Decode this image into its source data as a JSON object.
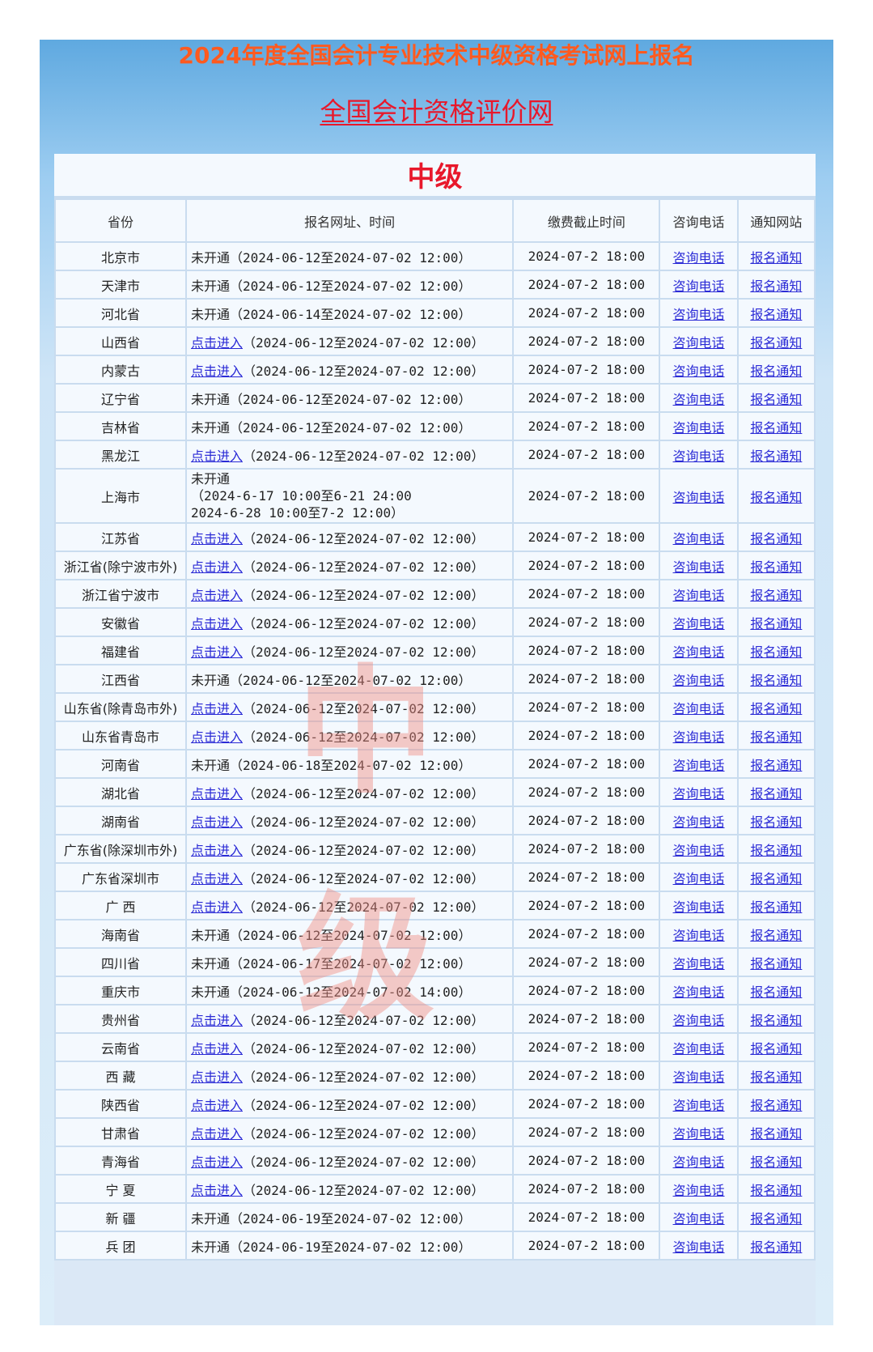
{
  "header": {
    "headline": "2024年度全国会计专业技术中级资格考试网上报名",
    "subtitle_link": "全国会计资格评价网"
  },
  "table": {
    "level_title": "中级",
    "watermark": "中级",
    "columns": [
      "省份",
      "报名网址、时间",
      "缴费截止时间",
      "咨询电话",
      "通知网站"
    ],
    "phone_link_label": "咨询电话",
    "notice_link_label": "报名通知",
    "rows": [
      {
        "province": "北京市",
        "status": "未开通",
        "status_link": false,
        "period": "（2024-06-12至2024-07-02 12:00）",
        "deadline": "2024-07-2 18:00"
      },
      {
        "province": "天津市",
        "status": "未开通",
        "status_link": false,
        "period": "（2024-06-12至2024-07-02 12:00）",
        "deadline": "2024-07-2 18:00"
      },
      {
        "province": "河北省",
        "status": "未开通",
        "status_link": false,
        "period": "（2024-06-14至2024-07-02 12:00）",
        "deadline": "2024-07-2 18:00"
      },
      {
        "province": "山西省",
        "status": "点击进入",
        "status_link": true,
        "period": "（2024-06-12至2024-07-02 12:00）",
        "deadline": "2024-07-2 18:00"
      },
      {
        "province": "内蒙古",
        "status": "点击进入",
        "status_link": true,
        "period": "（2024-06-12至2024-07-02 12:00）",
        "deadline": "2024-07-2 18:00"
      },
      {
        "province": "辽宁省",
        "status": "未开通",
        "status_link": false,
        "period": "（2024-06-12至2024-07-02 12:00）",
        "deadline": "2024-07-2 18:00"
      },
      {
        "province": "吉林省",
        "status": "未开通",
        "status_link": false,
        "period": "（2024-06-12至2024-07-02 12:00）",
        "deadline": "2024-07-2 18:00"
      },
      {
        "province": "黑龙江",
        "status": "点击进入",
        "status_link": true,
        "period": "（2024-06-12至2024-07-02 12:00）",
        "deadline": "2024-07-2 18:00"
      },
      {
        "province": "上海市",
        "status": "未开通",
        "status_link": false,
        "multiline": true,
        "period_line1": "（2024-6-17 10:00至6-21 24:00",
        "period_line2": "2024-6-28 10:00至7-2 12:00）",
        "deadline": "2024-07-2 18:00"
      },
      {
        "province": "江苏省",
        "status": "点击进入",
        "status_link": true,
        "period": "（2024-06-12至2024-07-02 12:00）",
        "deadline": "2024-07-2 18:00"
      },
      {
        "province": "浙江省(除宁波市外)",
        "status": "点击进入",
        "status_link": true,
        "period": "（2024-06-12至2024-07-02 12:00）",
        "deadline": "2024-07-2 18:00"
      },
      {
        "province": "浙江省宁波市",
        "status": "点击进入",
        "status_link": true,
        "period": "（2024-06-12至2024-07-02 12:00）",
        "deadline": "2024-07-2 18:00"
      },
      {
        "province": "安徽省",
        "status": "点击进入",
        "status_link": true,
        "period": "（2024-06-12至2024-07-02 12:00）",
        "deadline": "2024-07-2 18:00"
      },
      {
        "province": "福建省",
        "status": "点击进入",
        "status_link": true,
        "period": "（2024-06-12至2024-07-02 12:00）",
        "deadline": "2024-07-2 18:00"
      },
      {
        "province": "江西省",
        "status": "未开通",
        "status_link": false,
        "period": "（2024-06-12至2024-07-02 12:00）",
        "deadline": "2024-07-2 18:00"
      },
      {
        "province": "山东省(除青岛市外)",
        "status": "点击进入",
        "status_link": true,
        "period": "（2024-06-12至2024-07-02 12:00）",
        "deadline": "2024-07-2 18:00"
      },
      {
        "province": "山东省青岛市",
        "status": "点击进入",
        "status_link": true,
        "period": "（2024-06-12至2024-07-02 12:00）",
        "deadline": "2024-07-2 18:00"
      },
      {
        "province": "河南省",
        "status": "未开通",
        "status_link": false,
        "period": "（2024-06-18至2024-07-02 12:00）",
        "deadline": "2024-07-2 18:00"
      },
      {
        "province": "湖北省",
        "status": "点击进入",
        "status_link": true,
        "period": "（2024-06-12至2024-07-02 12:00）",
        "deadline": "2024-07-2 18:00"
      },
      {
        "province": "湖南省",
        "status": "点击进入",
        "status_link": true,
        "period": "（2024-06-12至2024-07-02 12:00）",
        "deadline": "2024-07-2 18:00"
      },
      {
        "province": "广东省(除深圳市外)",
        "status": "点击进入",
        "status_link": true,
        "period": "（2024-06-12至2024-07-02 12:00）",
        "deadline": "2024-07-2 18:00"
      },
      {
        "province": "广东省深圳市",
        "status": "点击进入",
        "status_link": true,
        "period": "（2024-06-12至2024-07-02 12:00）",
        "deadline": "2024-07-2 18:00"
      },
      {
        "province": "广 西",
        "status": "点击进入",
        "status_link": true,
        "period": "（2024-06-12至2024-07-02 12:00）",
        "deadline": "2024-07-2 18:00"
      },
      {
        "province": "海南省",
        "status": "未开通",
        "status_link": false,
        "period": "（2024-06-12至2024-07-02 12:00）",
        "deadline": "2024-07-2 18:00"
      },
      {
        "province": "四川省",
        "status": "未开通",
        "status_link": false,
        "period": "（2024-06-17至2024-07-02 12:00）",
        "deadline": "2024-07-2 18:00"
      },
      {
        "province": "重庆市",
        "status": "未开通",
        "status_link": false,
        "period": "（2024-06-12至2024-07-02 14:00）",
        "deadline": "2024-07-2 18:00"
      },
      {
        "province": "贵州省",
        "status": "点击进入",
        "status_link": true,
        "period": "（2024-06-12至2024-07-02 12:00）",
        "deadline": "2024-07-2 18:00"
      },
      {
        "province": "云南省",
        "status": "点击进入",
        "status_link": true,
        "period": "（2024-06-12至2024-07-02 12:00）",
        "deadline": "2024-07-2 18:00"
      },
      {
        "province": "西 藏",
        "status": "点击进入",
        "status_link": true,
        "period": "（2024-06-12至2024-07-02 12:00）",
        "deadline": "2024-07-2 18:00"
      },
      {
        "province": "陕西省",
        "status": "点击进入",
        "status_link": true,
        "period": "（2024-06-12至2024-07-02 12:00）",
        "deadline": "2024-07-2 18:00"
      },
      {
        "province": "甘肃省",
        "status": "点击进入",
        "status_link": true,
        "period": "（2024-06-12至2024-07-02 12:00）",
        "deadline": "2024-07-2 18:00"
      },
      {
        "province": "青海省",
        "status": "点击进入",
        "status_link": true,
        "period": "（2024-06-12至2024-07-02 12:00）",
        "deadline": "2024-07-2 18:00"
      },
      {
        "province": "宁 夏",
        "status": "点击进入",
        "status_link": true,
        "period": "（2024-06-12至2024-07-02 12:00）",
        "deadline": "2024-07-2 18:00"
      },
      {
        "province": "新 疆",
        "status": "未开通",
        "status_link": false,
        "period": "（2024-06-19至2024-07-02 12:00）",
        "deadline": "2024-07-2 18:00"
      },
      {
        "province": "兵 团",
        "status": "未开通",
        "status_link": false,
        "period": "（2024-06-19至2024-07-02 12:00）",
        "deadline": "2024-07-2 18:00"
      }
    ]
  }
}
